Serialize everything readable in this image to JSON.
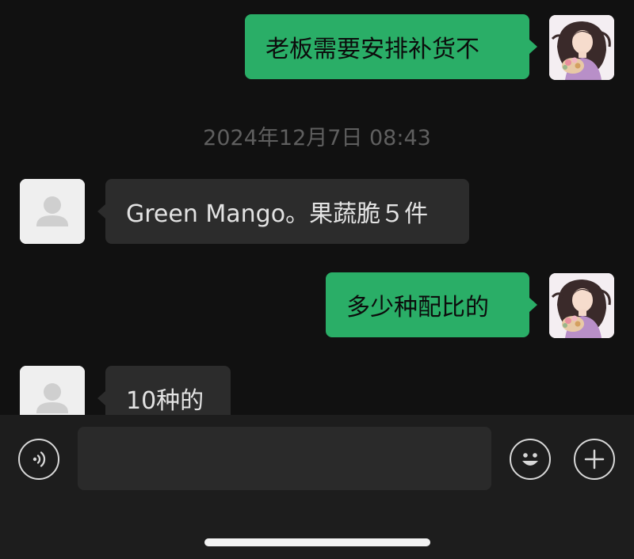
{
  "messages": [
    {
      "sender": "self",
      "text": "老板需要安排补货不"
    },
    {
      "sender": "other",
      "text": "Green Mango。果蔬脆５件"
    },
    {
      "sender": "self",
      "text": "多少种配比的"
    },
    {
      "sender": "other",
      "text": "10种的"
    }
  ],
  "timestamp": "2024年12月7日 08:43",
  "input": {
    "value": "",
    "placeholder": ""
  },
  "icons": {
    "voice": "voice-icon",
    "emoji": "emoji-icon",
    "add": "plus-icon",
    "self_avatar": "illustrated-girl-avatar",
    "other_avatar": "default-person-avatar"
  },
  "colors": {
    "background": "#111111",
    "self_bubble": "#2aae67",
    "other_bubble": "#2c2c2c",
    "toolbar": "#1d1d1d",
    "timestamp": "#5f5f5f"
  }
}
